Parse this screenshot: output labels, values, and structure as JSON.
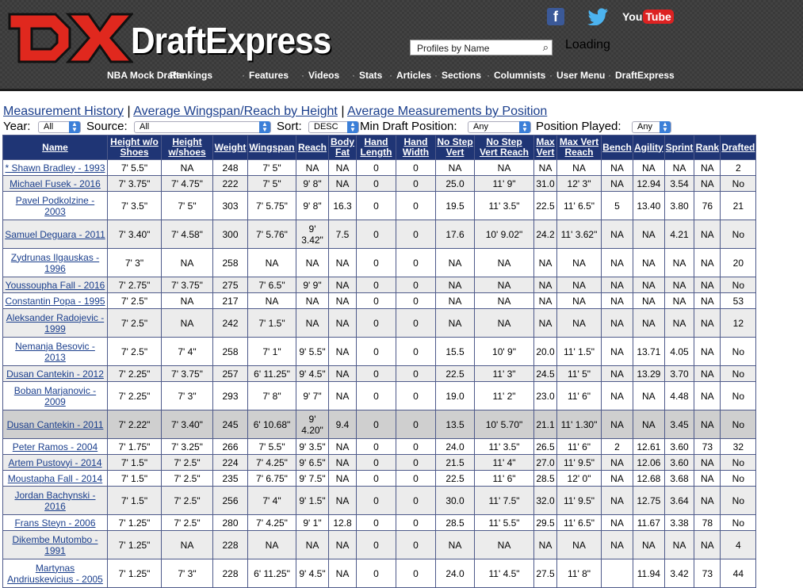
{
  "brand": {
    "logo_mark": "DX",
    "title": "DraftExpress"
  },
  "social": {
    "facebook": "f",
    "twitter": "twitter-bird",
    "youtube_you": "You",
    "youtube_tube": "Tube"
  },
  "search": {
    "placeholder": "Profiles by Name",
    "loading_text": "Loading"
  },
  "nav": [
    "NBA Mock Drafts",
    "Rankings",
    "Features",
    "Videos",
    "Stats",
    "Articles",
    "Sections",
    "Columnists",
    "User Menu",
    "DraftExpress"
  ],
  "links": [
    "Measurement History",
    "Average Wingspan/Reach by Height",
    "Average Measurements by Position"
  ],
  "link_sep": "|",
  "filters": {
    "year_label": "Year:",
    "year_value": "All",
    "source_label": "Source:",
    "source_value": "All",
    "sort_label": "Sort:",
    "sort_value": "DESC",
    "min_pos_label": "Min Draft Position:",
    "min_pos_value": "Any",
    "pos_label": "Position Played:",
    "pos_value": "Any"
  },
  "columns": [
    [
      "Name"
    ],
    [
      "Height w/o",
      "Shoes"
    ],
    [
      "Height",
      "w/shoes"
    ],
    [
      "Weight"
    ],
    [
      "Wingspan"
    ],
    [
      "Reach"
    ],
    [
      "Body",
      "Fat"
    ],
    [
      "Hand",
      "Length"
    ],
    [
      "Hand",
      "Width"
    ],
    [
      "No Step",
      "Vert"
    ],
    [
      "No Step",
      "Vert Reach"
    ],
    [
      "Max",
      "Vert"
    ],
    [
      "Max Vert",
      "Reach"
    ],
    [
      "Bench"
    ],
    [
      "Agility"
    ],
    [
      "Sprint"
    ],
    [
      "Rank"
    ],
    [
      "Drafted"
    ]
  ],
  "rows": [
    [
      [
        "* Shawn Bradley - 1993"
      ],
      "7' 5.5\"",
      "NA",
      "248",
      "7' 5\"",
      "NA",
      "NA",
      "0",
      "0",
      "NA",
      "NA",
      "NA",
      "NA",
      "NA",
      "NA",
      "NA",
      "NA",
      "2"
    ],
    [
      [
        "Michael Fusek - 2016"
      ],
      "7' 3.75\"",
      "7' 4.75\"",
      "222",
      "7' 5\"",
      "9' 8\"",
      "NA",
      "0",
      "0",
      "25.0",
      "11' 9\"",
      "31.0",
      "12' 3\"",
      "NA",
      "12.94",
      "3.54",
      "NA",
      "No"
    ],
    [
      [
        "Pavel Podkolzine -",
        "2003"
      ],
      "7' 3.5\"",
      "7' 5\"",
      "303",
      "7' 5.75\"",
      "9' 8\"",
      "16.3",
      "0",
      "0",
      "19.5",
      "11' 3.5\"",
      "22.5",
      "11' 6.5\"",
      "5",
      "13.40",
      "3.80",
      "76",
      "21"
    ],
    [
      [
        "Samuel Deguara - 2011"
      ],
      "7' 3.40\"",
      "7' 4.58\"",
      "300",
      "7' 5.76\"",
      "9' 3.42\"",
      "7.5",
      "0",
      "0",
      "17.6",
      "10' 9.02\"",
      "24.2",
      "11' 3.62\"",
      "NA",
      "NA",
      "4.21",
      "NA",
      "No"
    ],
    [
      [
        "Zydrunas Ilgauskas -",
        "1996"
      ],
      "7' 3\"",
      "NA",
      "258",
      "NA",
      "NA",
      "NA",
      "0",
      "0",
      "NA",
      "NA",
      "NA",
      "NA",
      "NA",
      "NA",
      "NA",
      "NA",
      "20"
    ],
    [
      [
        "Youssoupha Fall - 2016"
      ],
      "7' 2.75\"",
      "7' 3.75\"",
      "275",
      "7' 6.5\"",
      "9' 9\"",
      "NA",
      "0",
      "0",
      "NA",
      "NA",
      "NA",
      "NA",
      "NA",
      "NA",
      "NA",
      "NA",
      "No"
    ],
    [
      [
        "Constantin Popa - 1995"
      ],
      "7' 2.5\"",
      "NA",
      "217",
      "NA",
      "NA",
      "NA",
      "0",
      "0",
      "NA",
      "NA",
      "NA",
      "NA",
      "NA",
      "NA",
      "NA",
      "NA",
      "53"
    ],
    [
      [
        "Aleksander Radojevic -",
        "1999"
      ],
      "7' 2.5\"",
      "NA",
      "242",
      "7' 1.5\"",
      "NA",
      "NA",
      "0",
      "0",
      "NA",
      "NA",
      "NA",
      "NA",
      "NA",
      "NA",
      "NA",
      "NA",
      "12"
    ],
    [
      [
        "Nemanja Besovic -",
        "2013"
      ],
      "7' 2.5\"",
      "7' 4\"",
      "258",
      "7' 1\"",
      "9' 5.5\"",
      "NA",
      "0",
      "0",
      "15.5",
      "10' 9\"",
      "20.0",
      "11' 1.5\"",
      "NA",
      "13.71",
      "4.05",
      "NA",
      "No"
    ],
    [
      [
        "Dusan Cantekin - 2012"
      ],
      "7' 2.25\"",
      "7' 3.75\"",
      "257",
      "6' 11.25\"",
      "9' 4.5\"",
      "NA",
      "0",
      "0",
      "22.5",
      "11' 3\"",
      "24.5",
      "11' 5\"",
      "NA",
      "13.29",
      "3.70",
      "NA",
      "No"
    ],
    [
      [
        "Boban Marjanovic -",
        "2009"
      ],
      "7' 2.25\"",
      "7' 3\"",
      "293",
      "7' 8\"",
      "9' 7\"",
      "NA",
      "0",
      "0",
      "19.0",
      "11' 2\"",
      "23.0",
      "11' 6\"",
      "NA",
      "NA",
      "4.48",
      "NA",
      "No"
    ],
    [
      [
        "Dusan Cantekin - 2011"
      ],
      "7' 2.22\"",
      "7' 3.40\"",
      "245",
      "6' 10.68\"",
      "9' 4.20\"",
      "9.4",
      "0",
      "0",
      "13.5",
      "10' 5.70\"",
      "21.1",
      "11' 1.30\"",
      "NA",
      "NA",
      "3.45",
      "NA",
      "No"
    ],
    [
      [
        "Peter Ramos - 2004"
      ],
      "7' 1.75\"",
      "7' 3.25\"",
      "266",
      "7' 5.5\"",
      "9' 3.5\"",
      "NA",
      "0",
      "0",
      "24.0",
      "11' 3.5\"",
      "26.5",
      "11' 6\"",
      "2",
      "12.61",
      "3.60",
      "73",
      "32"
    ],
    [
      [
        "Artem Pustovyi - 2014"
      ],
      "7' 1.5\"",
      "7' 2.5\"",
      "224",
      "7' 4.25\"",
      "9' 6.5\"",
      "NA",
      "0",
      "0",
      "21.5",
      "11' 4\"",
      "27.0",
      "11' 9.5\"",
      "NA",
      "12.06",
      "3.60",
      "NA",
      "No"
    ],
    [
      [
        "Moustapha Fall - 2014"
      ],
      "7' 1.5\"",
      "7' 2.5\"",
      "235",
      "7' 6.75\"",
      "9' 7.5\"",
      "NA",
      "0",
      "0",
      "22.5",
      "11' 6\"",
      "28.5",
      "12' 0\"",
      "NA",
      "12.68",
      "3.68",
      "NA",
      "No"
    ],
    [
      [
        "Jordan Bachynski -",
        "2016"
      ],
      "7' 1.5\"",
      "7' 2.5\"",
      "256",
      "7' 4\"",
      "9' 1.5\"",
      "NA",
      "0",
      "0",
      "30.0",
      "11' 7.5\"",
      "32.0",
      "11' 9.5\"",
      "NA",
      "12.75",
      "3.64",
      "NA",
      "No"
    ],
    [
      [
        "Frans Steyn - 2006"
      ],
      "7' 1.25\"",
      "7' 2.5\"",
      "280",
      "7' 4.25\"",
      "9' 1\"",
      "12.8",
      "0",
      "0",
      "28.5",
      "11' 5.5\"",
      "29.5",
      "11' 6.5\"",
      "NA",
      "11.67",
      "3.38",
      "78",
      "No"
    ],
    [
      [
        "Dikembe Mutombo -",
        "1991"
      ],
      "7' 1.25\"",
      "NA",
      "228",
      "NA",
      "NA",
      "NA",
      "0",
      "0",
      "NA",
      "NA",
      "NA",
      "NA",
      "NA",
      "NA",
      "NA",
      "NA",
      "4"
    ],
    [
      [
        "Martynas",
        "Andriuskevicius - 2005"
      ],
      "7' 1.25\"",
      "7' 3\"",
      "228",
      "6' 11.25\"",
      "9' 4.5\"",
      "NA",
      "0",
      "0",
      "24.0",
      "11' 4.5\"",
      "27.5",
      "11' 8\"",
      "",
      "11.94",
      "3.42",
      "73",
      "44"
    ]
  ],
  "row_heights": [
    19,
    19,
    35,
    35,
    35,
    19,
    19,
    35,
    35,
    19,
    35,
    35,
    19,
    19,
    19,
    35,
    19,
    35,
    35
  ],
  "highlight_row": 11,
  "colors": {
    "header_bg": "#3a3a3a",
    "table_head": "#1f3575",
    "link": "#1a3e8c",
    "logo_red": "#e0281e"
  }
}
